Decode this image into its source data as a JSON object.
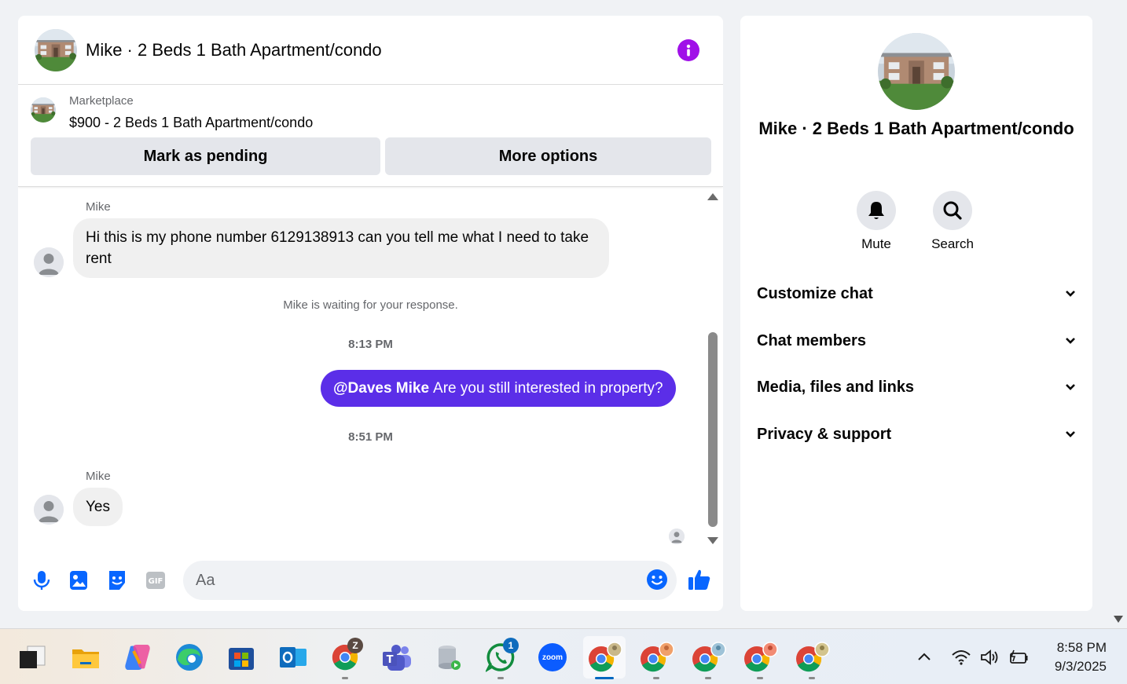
{
  "chat": {
    "title": "Mike · 2 Beds 1 Bath Apartment/condo",
    "marketplace": {
      "source": "Marketplace",
      "listing": "$900 - 2 Beds 1 Bath Apartment/condo",
      "pending_label": "Mark as pending",
      "more_label": "More options"
    },
    "messages": [
      {
        "sender": "Mike",
        "text": "Hi this is my phone number 6129138913 can you tell me what I need to take rent"
      },
      {
        "system": "Mike is waiting for your response."
      },
      {
        "time": "8:13 PM"
      },
      {
        "mention": "@Daves Mike",
        "text": "Are you still interested in property?"
      },
      {
        "time": "8:51 PM"
      },
      {
        "sender": "Mike",
        "text": "Yes"
      }
    ],
    "composer": {
      "placeholder": "Aa"
    }
  },
  "info": {
    "title": "Mike · 2 Beds 1 Bath Apartment/condo",
    "actions": [
      {
        "label": "Mute",
        "icon": "bell-icon"
      },
      {
        "label": "Search",
        "icon": "search-icon"
      }
    ],
    "sections": [
      "Customize chat",
      "Chat members",
      "Media, files and links",
      "Privacy & support"
    ]
  },
  "colors": {
    "accent": "#5b2ee8",
    "info_button": "#a010e8",
    "icon_blue": "#0866ff"
  },
  "taskbar": {
    "badges": {
      "chrome_z": "Z",
      "whatsapp": "1"
    },
    "zoom_label": "zoom",
    "time": "8:58 PM",
    "date": "9/3/2025"
  }
}
